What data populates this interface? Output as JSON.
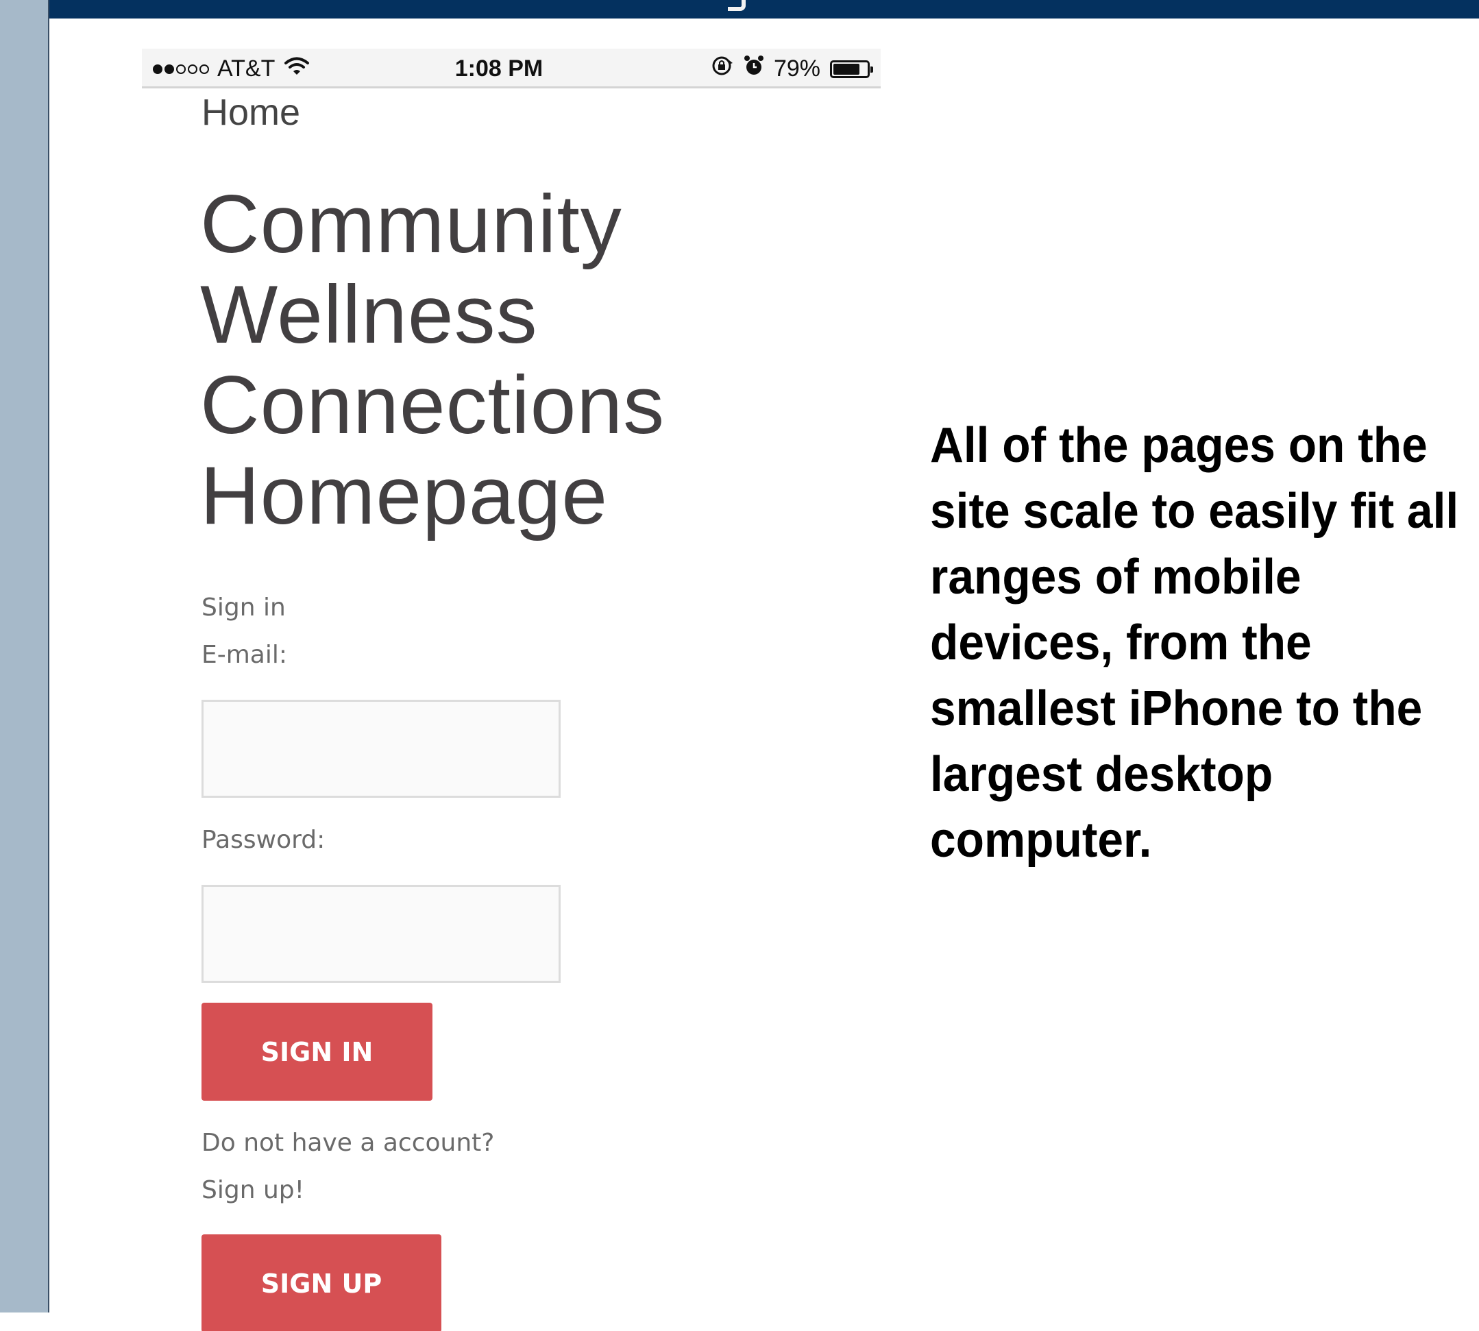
{
  "status_bar": {
    "carrier": "AT&T",
    "time": "1:08 PM",
    "battery_percent": "79%",
    "battery_level": 0.79,
    "signal_bars_filled": 2,
    "signal_bars_total": 5
  },
  "nav": {
    "home": "Home"
  },
  "page": {
    "title": "Community Wellness Connections Homepage"
  },
  "signin_form": {
    "heading": "Sign in",
    "email_label": "E-mail:",
    "email_value": "",
    "password_label": "Password:",
    "password_value": "",
    "signin_button": "SIGN IN"
  },
  "signup": {
    "prompt": "Do not have a account?",
    "cta": "Sign up!",
    "signup_button": "SIGN UP"
  },
  "description": "All of the pages on the site scale to easily fit all ranges of mobile devices, from the smallest iPhone to the largest desktop computer.",
  "colors": {
    "banner": "#04315f",
    "rail": "#a6b9c9",
    "button": "#d65053",
    "title_text": "#423f41"
  },
  "icons": [
    "wifi-icon",
    "orientation-lock-icon",
    "alarm-icon",
    "battery-icon"
  ]
}
